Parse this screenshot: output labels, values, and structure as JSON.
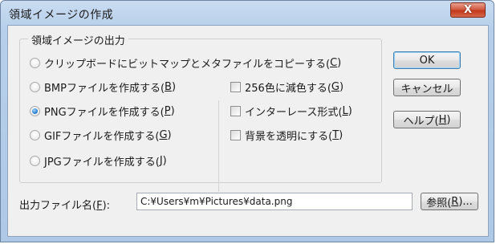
{
  "window": {
    "title": "領域イメージの作成",
    "close_label": "X"
  },
  "group": {
    "legend": "領域イメージの出力",
    "options": [
      {
        "pre": "クリップボードにビットマップとメタファイルをコピーする(",
        "key": "C",
        "post": ")",
        "checked": false
      },
      {
        "pre": "BMPファイルを作成する(",
        "key": "B",
        "post": ")",
        "checked": false
      },
      {
        "pre": "PNGファイルを作成する(",
        "key": "P",
        "post": ")",
        "checked": true
      },
      {
        "pre": "GIFファイルを作成する(",
        "key": "G",
        "post": ")",
        "checked": false
      },
      {
        "pre": "JPGファイルを作成する(",
        "key": "J",
        "post": ")",
        "checked": false
      }
    ],
    "checkboxes": [
      {
        "pre": "256色に減色する(",
        "key": "G",
        "post": ")",
        "checked": false
      },
      {
        "pre": "インターレース形式(",
        "key": "L",
        "post": ")",
        "checked": false
      },
      {
        "pre": "背景を透明にする(",
        "key": "T",
        "post": ")",
        "checked": false
      }
    ]
  },
  "buttons": {
    "ok": "OK",
    "cancel": "キャンセル",
    "help_pre": "ヘルプ(",
    "help_key": "H",
    "help_post": ")"
  },
  "output": {
    "label_pre": "出力ファイル名(",
    "label_key": "F",
    "label_post": "):",
    "value": "C:¥Users¥m¥Pictures¥data.png",
    "browse_pre": "参照(",
    "browse_key": "R",
    "browse_post": ")..."
  },
  "colors": {
    "titlebar": "#b7cfea",
    "close_button": "#c1391c",
    "dialog_bg": "#f0f0f0",
    "radio_selected": "#2a7fd0"
  }
}
